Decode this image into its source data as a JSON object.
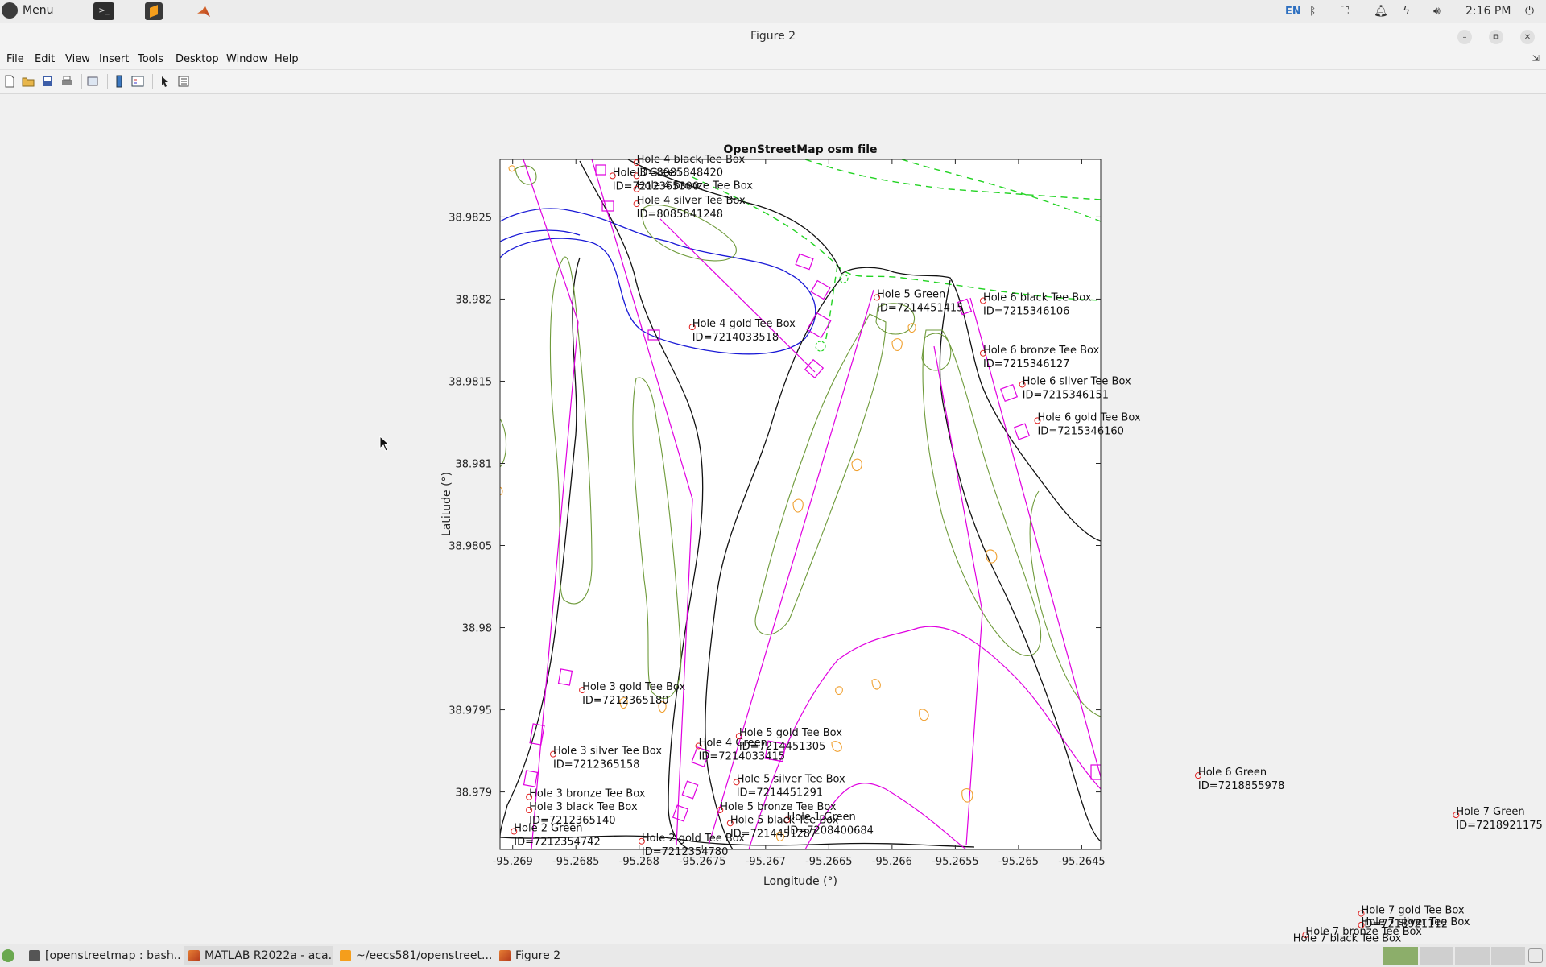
{
  "topbar": {
    "menu_label": "Menu",
    "lang": "EN",
    "clock": "2:16 PM"
  },
  "window": {
    "title": "Figure 2"
  },
  "menubar": [
    "File",
    "Edit",
    "View",
    "Insert",
    "Tools",
    "Desktop",
    "Window",
    "Help"
  ],
  "toolbar_icons": [
    "new-figure-icon",
    "open-file-icon",
    "save-icon",
    "print-icon",
    "link-plot-icon",
    "insert-colorbar-icon",
    "insert-legend-icon",
    "edit-plot-icon",
    "property-inspector-icon"
  ],
  "taskbar": {
    "items": [
      "[openstreetmap : bash...",
      "MATLAB R2022a - aca...",
      "~/eecs581/openstreet...",
      "Figure 2"
    ]
  },
  "chart_data": {
    "type": "map",
    "title": "OpenStreetMap osm file",
    "xlabel": "Longitude (°)",
    "ylabel": "Latitude (°)",
    "xlim": [
      -95.2691,
      -95.26435
    ],
    "ylim": [
      38.97865,
      38.98285
    ],
    "xticks": [
      "-95.269",
      "-95.2685",
      "-95.268",
      "-95.2675",
      "-95.267",
      "-95.2665",
      "-95.266",
      "-95.2655",
      "-95.265",
      "-95.2645"
    ],
    "xtick_values": [
      -95.269,
      -95.2685,
      -95.268,
      -95.2675,
      -95.267,
      -95.2665,
      -95.266,
      -95.2655,
      -95.265,
      -95.2645
    ],
    "yticks": [
      "38.9825",
      "38.982",
      "38.9815",
      "38.981",
      "38.9805",
      "38.98",
      "38.9795",
      "38.979"
    ],
    "ytick_values": [
      38.9825,
      38.982,
      38.9815,
      38.981,
      38.9805,
      38.98,
      38.9795,
      38.979
    ],
    "labels": [
      {
        "name": "Hole 4 black Tee Box",
        "id": "",
        "lon": -95.26802,
        "lat": 38.98283
      },
      {
        "name": "Hole 3 Green",
        "id": "ID=7212365300",
        "lon": -95.26821,
        "lat": 38.98275
      },
      {
        "name": "ID=8085848420",
        "id": "",
        "lon": -95.26802,
        "lat": 38.98275
      },
      {
        "name": "Hole 4 bronze Tee Box",
        "id": "",
        "lon": -95.26802,
        "lat": 38.98267
      },
      {
        "name": "Hole 4 silver Tee Box",
        "id": "ID=8085841248",
        "lon": -95.26802,
        "lat": 38.98258
      },
      {
        "name": "Hole 4 gold Tee Box",
        "id": "ID=7214033518",
        "lon": -95.26758,
        "lat": 38.98183
      },
      {
        "name": "Hole 5 Green",
        "id": "ID=7214451415",
        "lon": -95.26612,
        "lat": 38.98201
      },
      {
        "name": "Hole 6 black Tee Box",
        "id": "ID=7215346106",
        "lon": -95.26528,
        "lat": 38.98199
      },
      {
        "name": "Hole 6 bronze Tee Box",
        "id": "ID=7215346127",
        "lon": -95.26528,
        "lat": 38.98167
      },
      {
        "name": "Hole 6 silver Tee Box",
        "id": "ID=7215346151",
        "lon": -95.26497,
        "lat": 38.98148
      },
      {
        "name": "Hole 6 gold Tee Box",
        "id": "ID=7215346160",
        "lon": -95.26485,
        "lat": 38.98126
      },
      {
        "name": "Hole 3 gold Tee Box",
        "id": "ID=7212365180",
        "lon": -95.26845,
        "lat": 38.97962
      },
      {
        "name": "Hole 3 silver Tee Box",
        "id": "ID=7212365158",
        "lon": -95.26868,
        "lat": 38.97923
      },
      {
        "name": "Hole 4 Green",
        "id": "ID=7214033415",
        "lon": -95.26753,
        "lat": 38.97928
      },
      {
        "name": "Hole 5 gold Tee Box",
        "id": "ID=7214451305",
        "lon": -95.26721,
        "lat": 38.97934
      },
      {
        "name": "Hole 5 silver Tee Box",
        "id": "ID=7214451291",
        "lon": -95.26723,
        "lat": 38.97906
      },
      {
        "name": "Hole 3 bronze Tee Box",
        "id": "",
        "lon": -95.26887,
        "lat": 38.97897
      },
      {
        "name": "Hole 3 black Tee Box",
        "id": "ID=7212365140",
        "lon": -95.26887,
        "lat": 38.97889
      },
      {
        "name": "Hole 5 bronze Tee Box",
        "id": "",
        "lon": -95.26736,
        "lat": 38.97889
      },
      {
        "name": "Hole 1 Green",
        "id": "ID=7208400684",
        "lon": -95.26683,
        "lat": 38.97883
      },
      {
        "name": "Hole 5 black Tee Box",
        "id": "ID=7214451287",
        "lon": -95.26728,
        "lat": 38.97881
      },
      {
        "name": "Hole 2 Green",
        "id": "ID=7212354742",
        "lon": -95.26899,
        "lat": 38.97876
      },
      {
        "name": "Hole 2 gold Tee Box",
        "id": "ID=7212354780",
        "lon": -95.26798,
        "lat": 38.9787
      },
      {
        "name": "Hole 6 Green",
        "id": "ID=7218855978",
        "lon": -95.26358,
        "lat": 38.9791
      },
      {
        "name": "Hole 7 Green",
        "id": "ID=7218921175",
        "lon": -95.26154,
        "lat": 38.97886
      },
      {
        "name": "Hole 7 gold Tee Box",
        "id": "ID=7218921112",
        "lon": -95.26229,
        "lat": 38.97826
      },
      {
        "name": "Hole 7 silver Tee Box",
        "id": "",
        "lon": -95.26229,
        "lat": 38.97819
      },
      {
        "name": "Hole 7 bronze Tee Box",
        "id": "",
        "lon": -95.26273,
        "lat": 38.97813
      },
      {
        "name": "Hole 7 black Tee Box",
        "id": "",
        "lon": -95.26283,
        "lat": 38.97809
      }
    ]
  }
}
